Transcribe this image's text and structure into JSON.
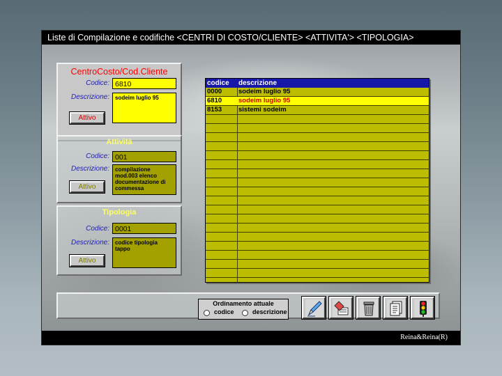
{
  "window": {
    "title": "Liste di Compilazione e codifiche <CENTRI DI COSTO/CLIENTE> <ATTIVITA'> <TIPOLOGIA>",
    "credit": "Reina&Reina(R)"
  },
  "panels": {
    "centro": {
      "title": "CentroCosto/Cod.Cliente",
      "codice_label": "Codice:",
      "codice_value": "6810",
      "descrizione_label": "Descrizione:",
      "descrizione_value": "sodeim luglio 95",
      "button_label": "Attivo"
    },
    "attivita": {
      "title": "Attività",
      "codice_label": "Codice:",
      "codice_value": "001",
      "descrizione_label": "Descrizione:",
      "descrizione_value": "compilazione mod.003 elenco documentazione di commessa",
      "button_label": "Attivo"
    },
    "tipologia": {
      "title": "Tipologia",
      "codice_label": "Codice:",
      "codice_value": "0001",
      "descrizione_label": "Descrizione:",
      "descrizione_value": "codice tipologia tappo",
      "button_label": "Attivo"
    }
  },
  "grid": {
    "headers": {
      "codice": "codice",
      "descrizione": "descrizione"
    },
    "rows": [
      {
        "codice": "0000",
        "descrizione": "sodeim luglio 95",
        "selected": false
      },
      {
        "codice": "6810",
        "descrizione": "sodeim luglio 95",
        "selected": true
      },
      {
        "codice": "8153",
        "descrizione": "sistemi sodeim",
        "selected": false
      }
    ],
    "empty_rows": 18
  },
  "ordering": {
    "title": "Ordinamento attuale",
    "options": [
      "codice",
      "descrizione"
    ]
  },
  "toolbar": {
    "icons": [
      "pencil-icon",
      "eraser-icon",
      "trash-can-icon",
      "document-icon",
      "traffic-light-icon"
    ]
  },
  "colors": {
    "title_bar": "#000000",
    "grid_header": "#1818a8",
    "grid_body": "#bcbc00",
    "selected_row": "#ffff00",
    "active_field": "#ffff00",
    "inactive_field": "#a3a100",
    "active_title": "#ff0000"
  }
}
